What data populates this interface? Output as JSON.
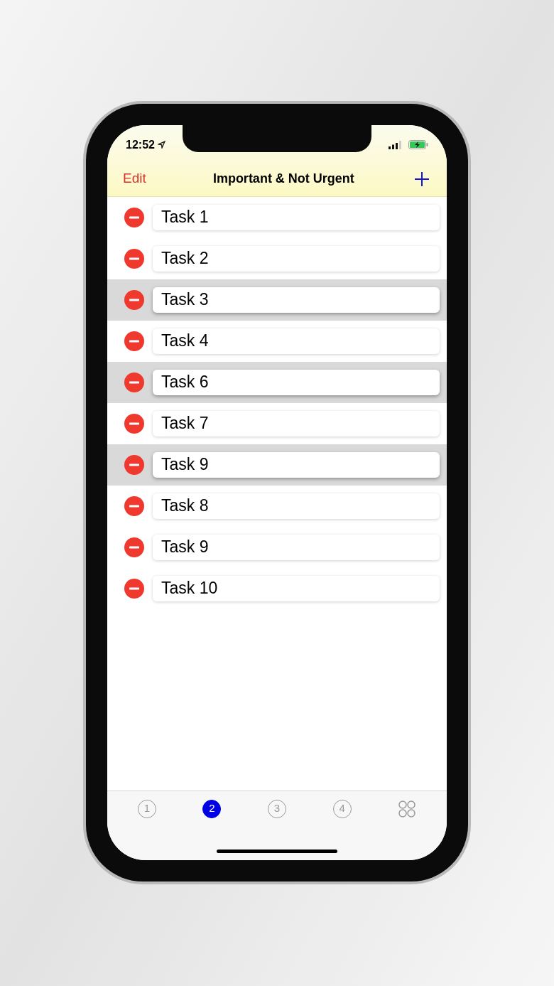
{
  "status_bar": {
    "time": "12:52"
  },
  "nav_bar": {
    "left_button": "Edit",
    "title": "Important & Not Urgent"
  },
  "tasks": [
    {
      "text": "Task 1",
      "selected": false
    },
    {
      "text": "Task 2",
      "selected": false
    },
    {
      "text": "Task 3",
      "selected": true
    },
    {
      "text": "Task 4",
      "selected": false
    },
    {
      "text": "Task 6",
      "selected": true
    },
    {
      "text": "Task 7",
      "selected": false
    },
    {
      "text": "Task 9",
      "selected": true
    },
    {
      "text": "Task 8",
      "selected": false
    },
    {
      "text": "Task 9",
      "selected": false
    },
    {
      "text": "Task 10",
      "selected": false
    }
  ],
  "tab_bar": [
    {
      "kind": "number",
      "label": "1",
      "selected": false
    },
    {
      "kind": "number",
      "label": "2",
      "selected": true
    },
    {
      "kind": "number",
      "label": "3",
      "selected": false
    },
    {
      "kind": "number",
      "label": "4",
      "selected": false
    },
    {
      "kind": "grid",
      "selected": false
    }
  ]
}
